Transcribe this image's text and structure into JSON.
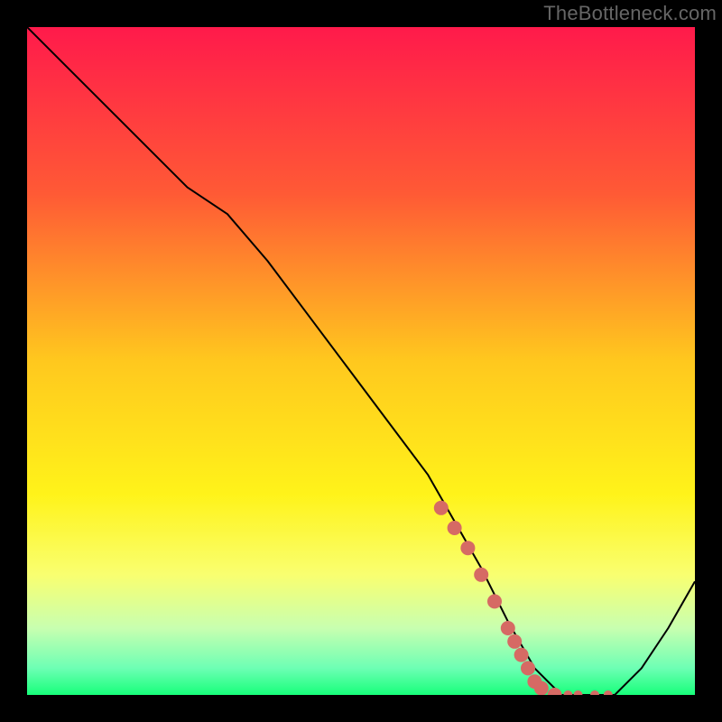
{
  "watermark": "TheBottleneck.com",
  "chart_data": {
    "type": "line",
    "title": "",
    "xlabel": "",
    "ylabel": "",
    "xlim": [
      0,
      100
    ],
    "ylim": [
      0,
      100
    ],
    "grid": false,
    "legend": false,
    "background": {
      "type": "vertical_gradient",
      "stops": [
        {
          "offset": 0.0,
          "color": "#ff1a4b"
        },
        {
          "offset": 0.25,
          "color": "#ff5a35"
        },
        {
          "offset": 0.5,
          "color": "#ffc81e"
        },
        {
          "offset": 0.7,
          "color": "#fff31a"
        },
        {
          "offset": 0.82,
          "color": "#f9ff70"
        },
        {
          "offset": 0.9,
          "color": "#c8ffb0"
        },
        {
          "offset": 0.96,
          "color": "#6dffb4"
        },
        {
          "offset": 1.0,
          "color": "#17ff7a"
        }
      ]
    },
    "series": [
      {
        "name": "bottleneck-curve",
        "color": "#000000",
        "width": 2,
        "x": [
          0,
          6,
          12,
          18,
          24,
          30,
          36,
          42,
          48,
          54,
          60,
          64,
          68,
          72,
          76,
          80,
          84,
          88,
          92,
          96,
          100
        ],
        "y": [
          100,
          94,
          88,
          82,
          76,
          72,
          65,
          57,
          49,
          41,
          33,
          26,
          19,
          11,
          4,
          0,
          0,
          0,
          4,
          10,
          17
        ]
      }
    ],
    "highlight": {
      "name": "highlight-dots",
      "color": "#d66a64",
      "radius_large": 8,
      "radius_small": 5,
      "points": [
        {
          "x": 62,
          "y": 28
        },
        {
          "x": 64,
          "y": 25
        },
        {
          "x": 66,
          "y": 22
        },
        {
          "x": 68,
          "y": 18
        },
        {
          "x": 70,
          "y": 14
        },
        {
          "x": 72,
          "y": 10
        },
        {
          "x": 73,
          "y": 8
        },
        {
          "x": 74,
          "y": 6
        },
        {
          "x": 75,
          "y": 4
        },
        {
          "x": 76,
          "y": 2
        },
        {
          "x": 77,
          "y": 1
        },
        {
          "x": 79,
          "y": 0
        },
        {
          "x": 81,
          "y": 0
        },
        {
          "x": 82.5,
          "y": 0
        },
        {
          "x": 85,
          "y": 0
        },
        {
          "x": 87,
          "y": 0
        }
      ]
    }
  }
}
